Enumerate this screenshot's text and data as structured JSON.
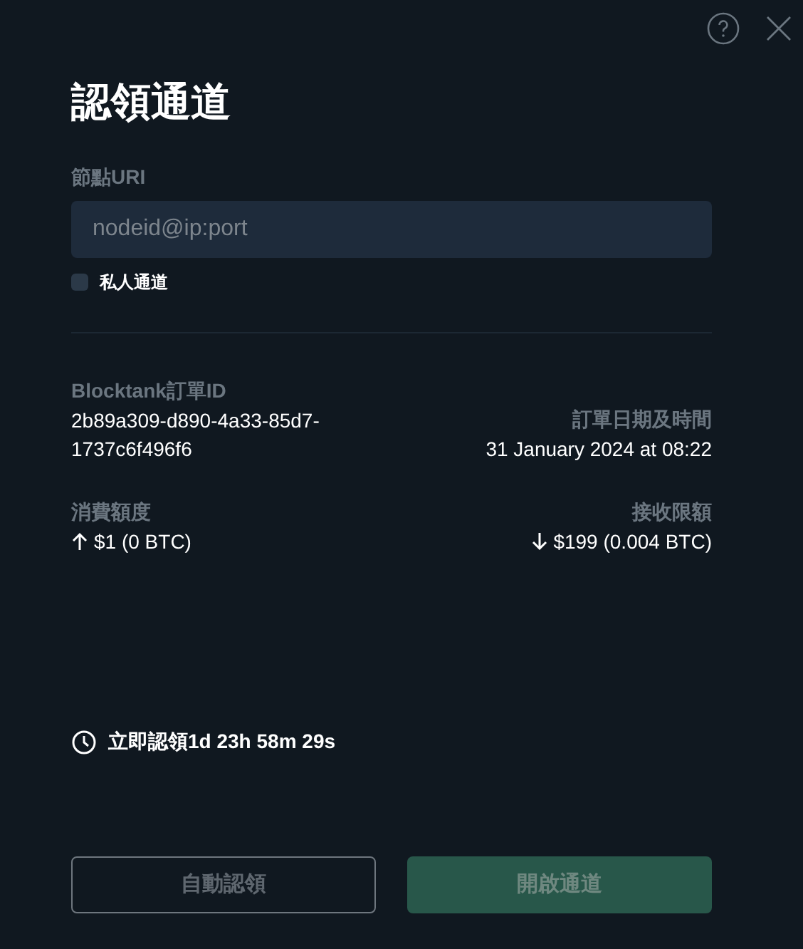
{
  "title": "認領通道",
  "node_uri": {
    "label": "節點URI",
    "placeholder": "nodeid@ip:port"
  },
  "private_channel": {
    "label": "私人通道",
    "checked": false
  },
  "order": {
    "id_label": "Blocktank訂單ID",
    "id_lines": [
      "2b89a309-d890-4a33-85d7-",
      "1737c6f496f6"
    ],
    "date_label": "訂單日期及時間",
    "date": "31 January 2024 at 08:22"
  },
  "amounts": [
    {
      "label": "消費額度",
      "kind": "up",
      "value": "$1 (0 BTC)"
    },
    {
      "label": "接收限額",
      "kind": "down",
      "value": "$199 (0.004 BTC)"
    }
  ],
  "countdown": "立即認領1d 23h 58m 29s",
  "buttons": [
    {
      "label": "自動認領",
      "kind": "outline",
      "disabled": true
    },
    {
      "label": "開啟通道",
      "kind": "primary",
      "disabled": true
    }
  ]
}
